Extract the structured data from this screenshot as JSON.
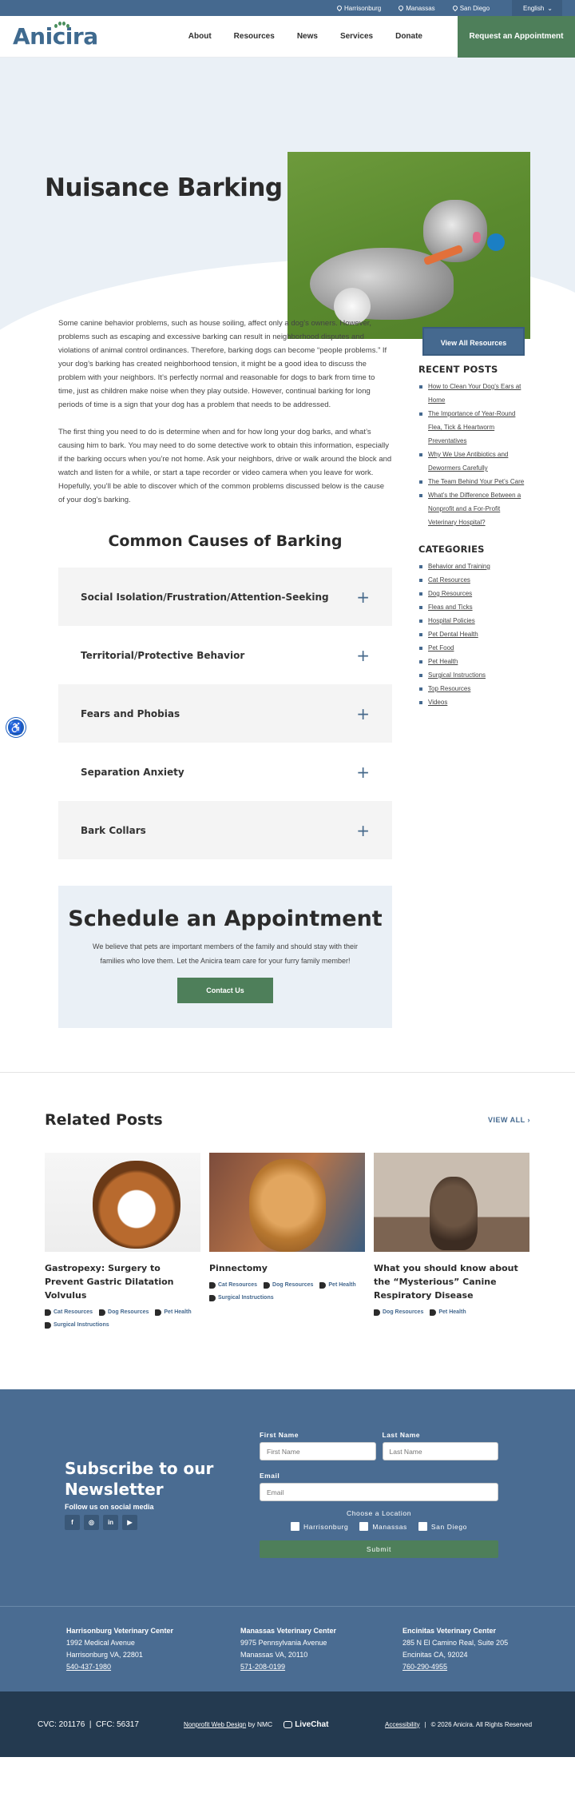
{
  "topbar": {
    "locations": [
      "Harrisonburg",
      "Manassas",
      "San Diego"
    ],
    "language": "English"
  },
  "header": {
    "logo": "Anicira",
    "nav": [
      "About",
      "Resources",
      "News",
      "Services",
      "Donate"
    ],
    "cta": "Request an Appointment"
  },
  "hero": {
    "title": "Nuisance Barking"
  },
  "article": {
    "paragraphs": [
      "Some canine behavior problems, such as house soiling, affect only a dog’s owners. However, problems such as escaping and excessive barking can result in neighborhood disputes and violations of animal control ordinances. Therefore, barking dogs can become “people problems.” If your dog’s barking has created neighborhood tension, it might be a good idea to discuss the problem with your neighbors. It’s perfectly normal and reasonable for dogs to bark from time to time, just as children make noise when they play outside. However, continual barking for long periods of time is a sign that your dog has a problem that needs to be addressed.",
      "The first thing you need to do is determine when and for how long your dog barks, and what’s causing him to bark. You may need to do some detective work to obtain this information, especially if the barking occurs when you’re not home. Ask your neighbors, drive or walk around the block and watch and listen for a while, or start a tape recorder or video camera when you leave for work. Hopefully, you’ll be able to discover which of the common problems discussed below is the cause of your dog’s barking."
    ],
    "causes_title": "Common Causes of Barking",
    "accordion": [
      "Social Isolation/Frustration/Attention-Seeking",
      "Territorial/Protective Behavior",
      "Fears and Phobias",
      "Separation Anxiety",
      "Bark Collars"
    ]
  },
  "schedule": {
    "title": "Schedule an Appointment",
    "text": "We believe that pets are important members of the family and should stay with their families who love them. Let the Anicira team care for your furry family member!",
    "button": "Contact Us"
  },
  "sidebar": {
    "view_all": "View All Resources",
    "recent_title": "RECENT POSTS",
    "recent": [
      "How to Clean Your Dog’s Ears at Home",
      "The Importance of Year-Round Flea, Tick & Heartworm Preventatives",
      "Why We Use Antibiotics and Dewormers Carefully",
      "The Team Behind Your Pet’s Care",
      "What’s the Difference Between a Nonprofit and a For-Profit Veterinary Hospital?"
    ],
    "categories_title": "CATEGORIES",
    "categories": [
      "Behavior and Training",
      "Cat Resources",
      "Dog Resources",
      "Fleas and Ticks",
      "Hospital Policies",
      "Pet Dental Health",
      "Pet Food",
      "Pet Health",
      "Surgical Instructions",
      "Top Resources",
      "Videos"
    ]
  },
  "related": {
    "title": "Related Posts",
    "view_all": "VIEW ALL",
    "posts": [
      {
        "title": "Gastropexy: Surgery to Prevent Gastric Dilatation Volvulus",
        "tags": [
          "Cat Resources",
          "Dog Resources",
          "Pet Health",
          "Surgical Instructions"
        ]
      },
      {
        "title": "Pinnectomy",
        "tags": [
          "Cat Resources",
          "Dog Resources",
          "Pet Health",
          "Surgical Instructions"
        ]
      },
      {
        "title": "What you should know about the “Mysterious” Canine Respiratory Disease",
        "tags": [
          "Dog Resources",
          "Pet Health"
        ]
      }
    ]
  },
  "newsletter": {
    "title": "Subscribe to our Newsletter",
    "follow": "Follow us on social media",
    "socials": [
      "facebook-icon",
      "instagram-icon",
      "linkedin-icon",
      "youtube-icon"
    ],
    "first_name_label": "First Name",
    "first_name_placeholder": "First Name",
    "last_name_label": "Last Name",
    "last_name_placeholder": "Last Name",
    "email_label": "Email",
    "email_placeholder": "Email",
    "choose": "Choose a Location",
    "locations": [
      "Harrisonburg",
      "Manassas",
      "San Diego"
    ],
    "submit": "Submit"
  },
  "locations": [
    {
      "name": "Harrisonburg Veterinary Center",
      "line1": "1992 Medical Avenue",
      "line2": "Harrisonburg VA, 22801",
      "phone": "540-437-1980"
    },
    {
      "name": "Manassas Veterinary Center",
      "line1": "9975 Pennsylvania Avenue",
      "line2": "Manassas VA, 20110",
      "phone": "571-208-0199"
    },
    {
      "name": "Encinitas Veterinary Center",
      "line1": "285 N El Camino Real, Suite 205",
      "line2": "Encinitas CA, 92024",
      "phone": "760-290-4955"
    }
  ],
  "footer": {
    "cvc": "CVC: 201176",
    "cfc": "CFC: 56317",
    "design_link": "Nonprofit Web Design",
    "design_by": "by NMC",
    "livechat": "LiveChat",
    "accessibility": "Accessibility",
    "copyright": "© 2026 Anicira. All Rights Reserved"
  },
  "colors": {
    "brand": "#45698f",
    "green": "#4e7f5a",
    "light": "#eaf0f6",
    "dark": "#243a50"
  }
}
